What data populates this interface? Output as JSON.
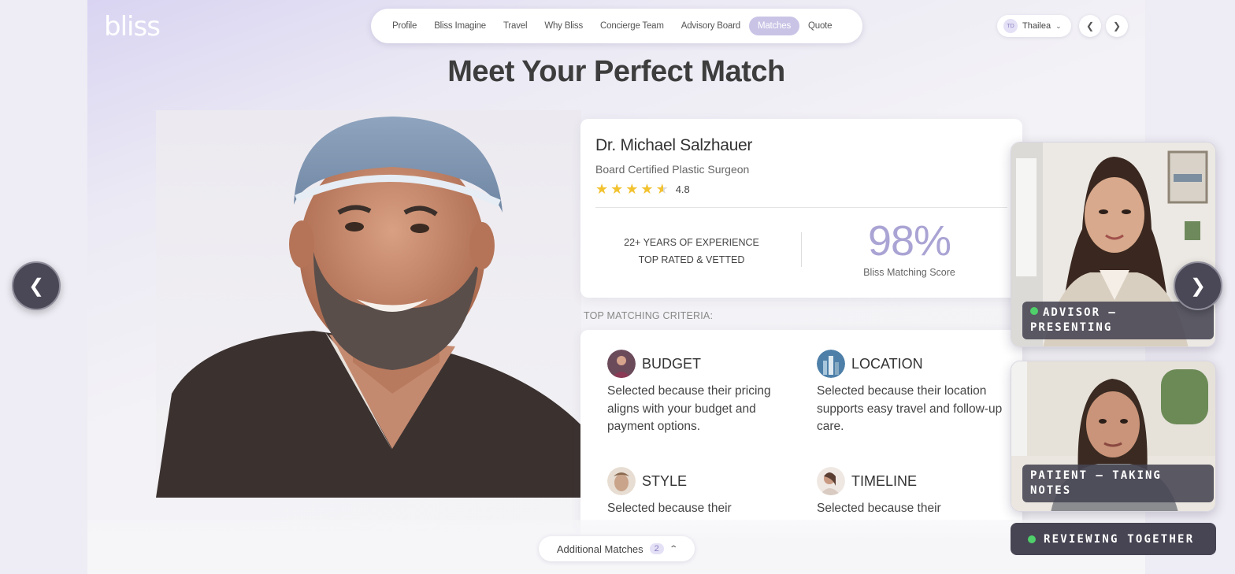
{
  "brand": {
    "logo": "bliss"
  },
  "nav": {
    "items": [
      {
        "label": "Profile"
      },
      {
        "label": "Bliss Imagine"
      },
      {
        "label": "Travel"
      },
      {
        "label": "Why Bliss"
      },
      {
        "label": "Concierge Team"
      },
      {
        "label": "Advisory Board"
      },
      {
        "label": "Matches",
        "active": true
      },
      {
        "label": "Quote"
      }
    ]
  },
  "user": {
    "initials": "TD",
    "name": "Thailea"
  },
  "headline": "Meet Your Perfect Match",
  "doctor": {
    "name": "Dr. Michael Salzhauer",
    "title": "Board Certified Plastic Surgeon",
    "rating": "4.8",
    "rating_stars": 4.5,
    "experience": "22+ YEARS OF EXPERIENCE",
    "vetted": "TOP RATED & VETTED",
    "score": "98%",
    "score_label": "Bliss Matching Score"
  },
  "criteria": {
    "heading": "TOP MATCHING CRITERIA:",
    "items": [
      {
        "title": "BUDGET",
        "text": "Selected because their pricing aligns with your budget and payment options."
      },
      {
        "title": "LOCATION",
        "text": "Selected because their location supports easy travel and follow-up care."
      },
      {
        "title": "STYLE",
        "text": "Selected because their"
      },
      {
        "title": "TIMELINE",
        "text": "Selected because their"
      }
    ]
  },
  "additional_matches": {
    "label": "Additional Matches",
    "count": "2"
  },
  "video": {
    "advisor_label": "ADVISOR — PRESENTING",
    "patient_label": "PATIENT — TAKING NOTES",
    "status": "REVIEWING TOGETHER"
  },
  "arrows": {
    "prev": "❮",
    "next": "❯"
  },
  "colors": {
    "accent": "#aaa4d4",
    "active_nav": "#c9c4e6",
    "live_dot": "#4fd06a",
    "star": "#f2c230"
  }
}
